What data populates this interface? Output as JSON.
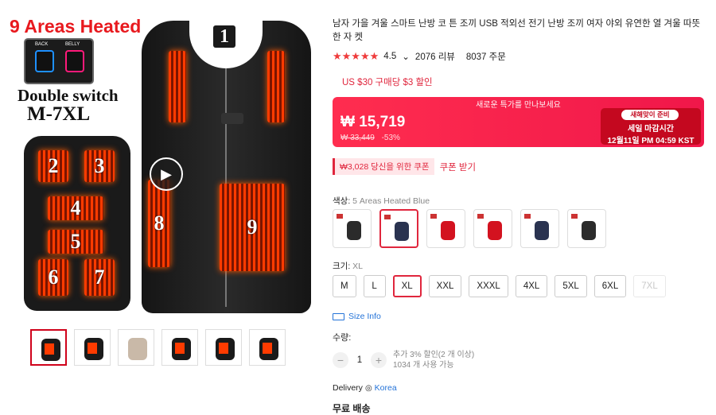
{
  "gallery": {
    "banner_title": "9 Areas Heated",
    "switch_labels": [
      "BACK",
      "BELLY"
    ],
    "double_switch": "Double switch",
    "size_range": "M-7XL",
    "zone_numbers": [
      "1",
      "2",
      "3",
      "4",
      "5",
      "6",
      "7",
      "8",
      "9"
    ],
    "thumbnail_count": 6
  },
  "product": {
    "title": "남자 가을 겨울 스마트 난방 코 튼 조끼 USB 적외선 전기 난방 조끼 여자 야외 유연한 열 겨울 따뜻한 자 켓",
    "rating": "4.5",
    "reviews": "2076 리뷰",
    "orders": "8037 주문",
    "promo": "US $30 구매당 $3 할인"
  },
  "price_banner": {
    "top_text": "새로운 특가를 만나보세요",
    "price": "₩ 15,719",
    "original_price": "₩ 33,449",
    "discount": "-53%",
    "countdown_chip": "새해맞이 준비",
    "countdown_label": "세일 마감시간",
    "countdown_time": "12월11일 PM 04:59 KST"
  },
  "coupon": {
    "badge": "₩3,028 당신을 위한 쿠폰",
    "link": "쿠폰 받기"
  },
  "color": {
    "label": "색상:",
    "selected": "5 Areas Heated Blue",
    "swatches": [
      {
        "color": "#2b2b2b"
      },
      {
        "color": "#2a3350"
      },
      {
        "color": "#d3121f"
      },
      {
        "color": "#d3121f"
      },
      {
        "color": "#2a3350"
      },
      {
        "color": "#2b2b2b"
      }
    ]
  },
  "size": {
    "label": "크기:",
    "selected": "XL",
    "options": [
      "M",
      "L",
      "XL",
      "XXL",
      "XXXL",
      "4XL",
      "5XL",
      "6XL",
      "7XL"
    ]
  },
  "size_info": "Size Info",
  "quantity": {
    "label": "수량:",
    "value": "1",
    "note_line1": "추가 3% 할인(2 개 이상)",
    "note_line2": "1034 개 사용 가능"
  },
  "delivery": {
    "label": "Delivery",
    "location": "Korea"
  },
  "shipping": "무료 배송",
  "accent_color": "#e0263d"
}
